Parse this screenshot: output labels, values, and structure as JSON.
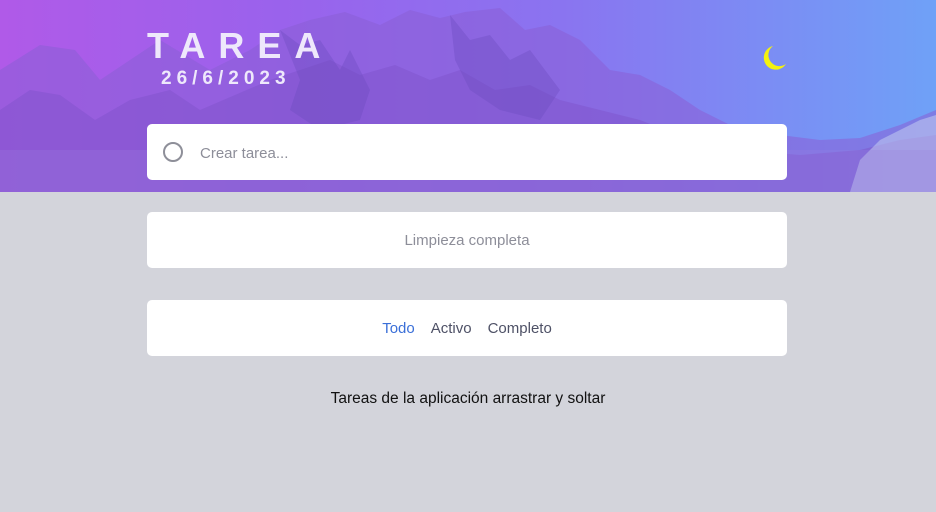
{
  "header": {
    "title": "TAREA",
    "date": "26/6/2023",
    "theme_icon": "moon-icon",
    "moon_color": "#f4f20e"
  },
  "create_task": {
    "placeholder": "Crear tarea...",
    "value": ""
  },
  "clear_button": {
    "label": "Limpieza completa"
  },
  "filters": {
    "items": [
      {
        "label": "Todo",
        "active": true
      },
      {
        "label": "Activo",
        "active": false
      },
      {
        "label": "Completo",
        "active": false
      }
    ],
    "active_color": "#3a6fd8"
  },
  "footer": {
    "note": "Tareas de la aplicación arrastrar y soltar"
  }
}
